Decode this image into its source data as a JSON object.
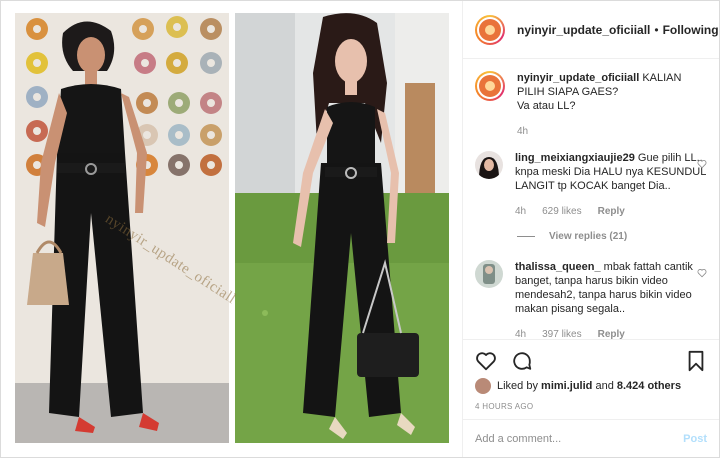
{
  "header": {
    "username": "nyinyir_update_oficiiall",
    "separator": "•",
    "follow_label": "Following"
  },
  "caption": {
    "username": "nyinyir_update_oficiiall",
    "text_line1": "KALIAN PILIH SIAPA GAES?",
    "text_line2": "Va atau LL?",
    "time": "4h"
  },
  "comments": [
    {
      "username": "ling_meixiangxiaujie29",
      "text": "Gue pilih LL.. knpa meski Dia HALU nya KESUNDUL LANGIT tp KOCAK banget Dia..",
      "time": "4h",
      "likes": "629 likes",
      "reply_label": "Reply",
      "view_replies": "View replies (21)"
    },
    {
      "username": "thalissa_queen_",
      "text": "mbak fattah cantik banget, tanpa harus bikin video mendesah2, tanpa harus bikin video makan pisang segala..",
      "time": "4h",
      "likes": "397 likes",
      "reply_label": "Reply"
    }
  ],
  "likes": {
    "prefix": "Liked by",
    "user": "mimi.julid",
    "connector": "and",
    "count": "8.424 others"
  },
  "timestamp": "4 HOURS AGO",
  "add_comment": {
    "placeholder": "Add a comment...",
    "post_label": "Post"
  },
  "watermark": "nyinyir_update_oficiall",
  "icons": {
    "like": "heart-icon",
    "comment": "comment-icon",
    "bookmark": "bookmark-icon"
  },
  "colors": {
    "accent_disabled": "#b2dffc",
    "secondary_text": "#8e8e8e"
  }
}
